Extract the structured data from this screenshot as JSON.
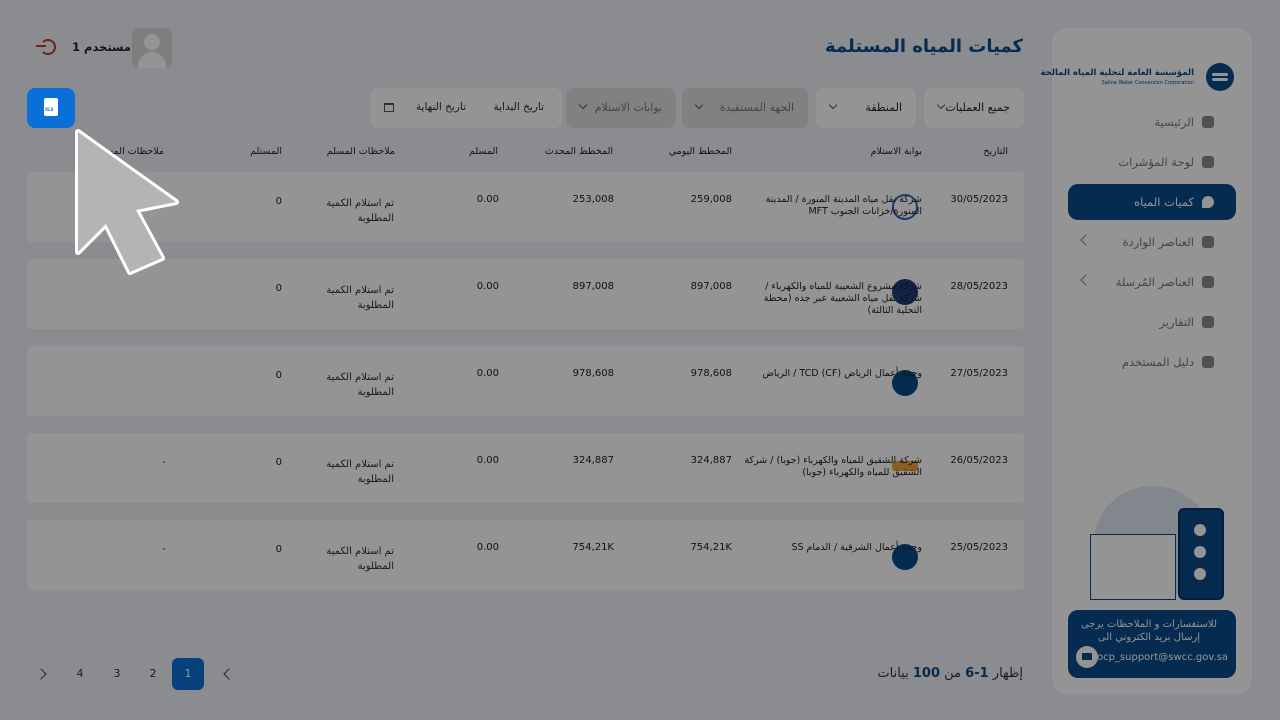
{
  "header": {
    "title": "كميات المياه المستلمة",
    "user_name": "مستخدم 1"
  },
  "sidebar": {
    "logo_text": "المؤسسة العامة لتحلية المياه المالحة",
    "logo_sub": "Saline Water Conversion Corporation",
    "items": [
      {
        "label": "الرئيسية",
        "icon": "dashboard-icon"
      },
      {
        "label": "لوحة المؤشرات",
        "icon": "pie-chart-icon"
      },
      {
        "label": "كميات المياه",
        "icon": "water-drop-icon",
        "active": true
      },
      {
        "label": "العناصر الواردة",
        "icon": "inbox-icon",
        "has_submenu": true
      },
      {
        "label": "العناصر المُرسلة",
        "icon": "outbox-icon",
        "has_submenu": true
      },
      {
        "label": "التقارير",
        "icon": "report-icon"
      },
      {
        "label": "دليل المستخدم",
        "icon": "book-icon"
      }
    ],
    "contact_text": "للاستفسارات و الملاحظات يرجى إرسال بريد الكتروني الى",
    "contact_email": "ocp_support@swcc.gov.sa"
  },
  "filters": {
    "operations": "جميع العمليات",
    "region": "المنطقة",
    "beneficiary": "الجهة المستفيدة",
    "gates": "بوابات الاستلام",
    "start_date": "تاريخ البداية",
    "end_date": "تاريخ النهاية",
    "export_label": "XLS"
  },
  "table": {
    "columns": [
      "التاريخ",
      "بوابة الاستلام",
      "المخطط اليومي",
      "المخطط المحدث",
      "المسلم",
      "ملاحظات المسلم",
      "المستلم",
      "ملاحظات المستلم"
    ],
    "rows": [
      {
        "date": "30/05/2023",
        "gate": "شركة نقل مياه المدينة المنورة / المدينة المنورة/خزانات الجنوب MFT",
        "daily": "259,008",
        "updated": "253,008",
        "delivered": "0.00",
        "note": "تم استلام الكمية المطلوبة",
        "received": "0",
        "recv_note": ""
      },
      {
        "date": "28/05/2023",
        "gate": "شركة مشروع الشعيبة للمياه والكهرباء / شركة نقل مياه الشعيبة عبر جده (محطة التحلية الثالثة)",
        "daily": "897,008",
        "updated": "897,008",
        "delivered": "0.00",
        "note": "تم استلام الكمية المطلوبة",
        "received": "0",
        "recv_note": ""
      },
      {
        "date": "27/05/2023",
        "gate": "وحدة أعمال الرياض TCD (CF) / الرياض",
        "daily": "978,608",
        "updated": "978,608",
        "delivered": "0.00",
        "note": "تم استلام الكمية المطلوبة",
        "received": "0",
        "recv_note": ""
      },
      {
        "date": "26/05/2023",
        "gate": "شركة الشقيق للمياه والكهرباء (جوبا) / شركة الشقيق للمياه والكهرباء (جوبا)",
        "daily": "324,887",
        "updated": "324,887",
        "delivered": "0.00",
        "note": "تم استلام الكمية المطلوبة",
        "received": "0",
        "recv_note": "-"
      },
      {
        "date": "25/05/2023",
        "gate": "وحدة أعمال الشرقية / الدمام SS",
        "daily": "754,21K",
        "updated": "754,21K",
        "delivered": "0.00",
        "note": "تم استلام الكمية المطلوبة",
        "received": "0",
        "recv_note": "-"
      }
    ]
  },
  "pagination": {
    "pages": [
      "1",
      "2",
      "3",
      "4"
    ],
    "summary_prefix": "إظهار",
    "summary_range": "1-6",
    "summary_of": "من",
    "summary_total": "100",
    "summary_suffix": "بيانات"
  },
  "colors": {
    "primary": "#0b4a8b",
    "accent": "#0b6fd8",
    "danger": "#c0392b"
  }
}
